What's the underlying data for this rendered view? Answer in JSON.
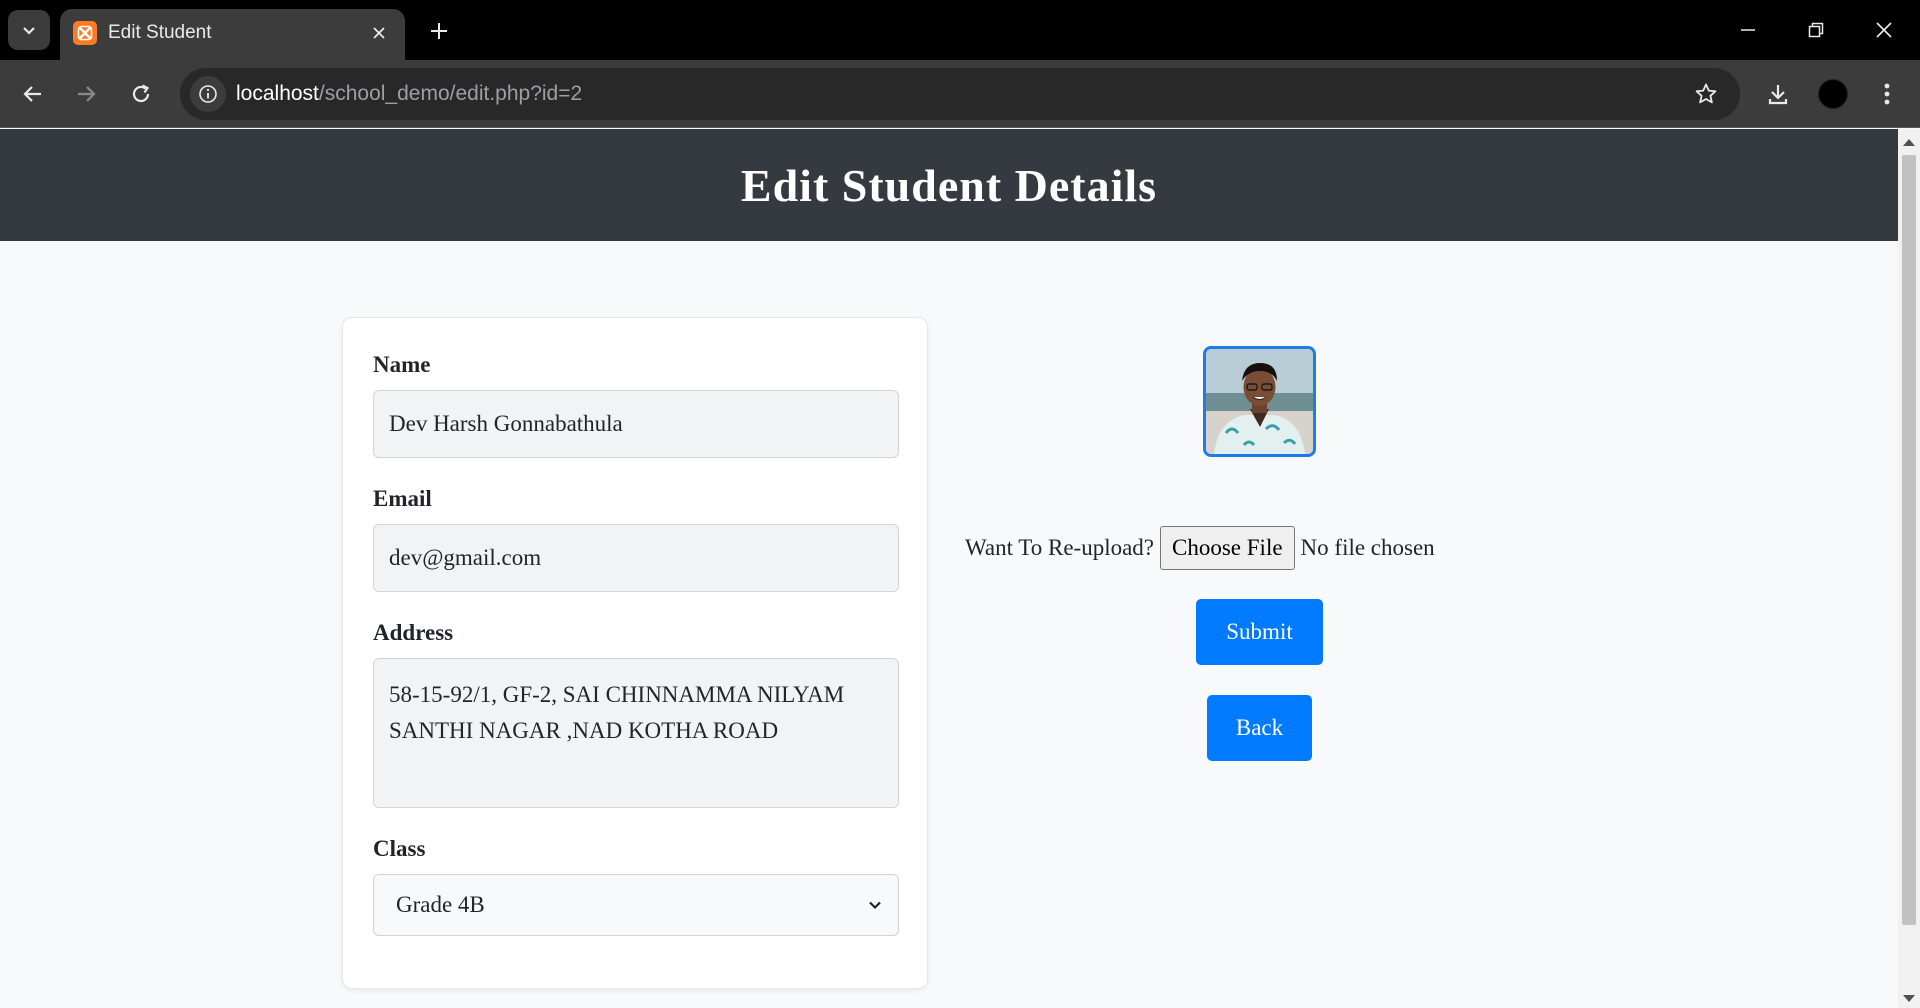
{
  "browser": {
    "tab_title": "Edit Student",
    "url_host": "localhost",
    "url_path": "/school_demo/edit.php?id=2"
  },
  "page": {
    "title": "Edit Student Details"
  },
  "form": {
    "name_label": "Name",
    "name_value": "Dev Harsh Gonnabathula",
    "email_label": "Email",
    "email_value": "dev@gmail.com",
    "address_label": "Address",
    "address_line1": "58-15-92/1, GF-2, SAI CHINNAMMA NILYAM",
    "address_line2": "SANTHI NAGAR ,NAD KOTHA ROAD",
    "class_label": "Class",
    "class_value": "Grade 4B"
  },
  "upload": {
    "prompt": "Want To Re-upload?",
    "choose_label": "Choose File",
    "status": "No file chosen"
  },
  "buttons": {
    "submit": "Submit",
    "back": "Back"
  },
  "colors": {
    "header_bg": "#343a40",
    "primary": "#007bff",
    "favicon": "#fb7a24"
  }
}
